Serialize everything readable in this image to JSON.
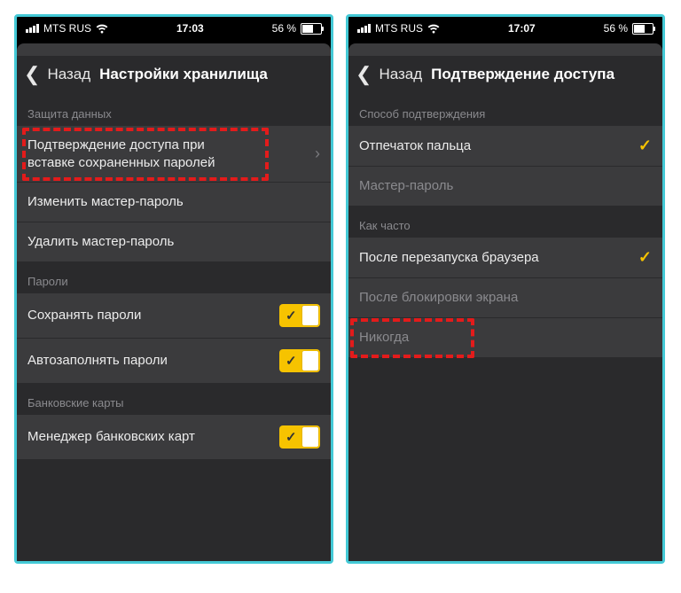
{
  "left": {
    "status": {
      "carrier": "MTS RUS",
      "time": "17:03",
      "battery": "56 %"
    },
    "nav": {
      "back": "Назад",
      "title": "Настройки хранилища"
    },
    "section1": {
      "header": "Защита данных",
      "row1": "Подтверждение доступа при вставке сохраненных паролей",
      "row2": "Изменить мастер-пароль",
      "row3": "Удалить мастер-пароль"
    },
    "section2": {
      "header": "Пароли",
      "row1": "Сохранять пароли",
      "row2": "Автозаполнять пароли"
    },
    "section3": {
      "header": "Банковские карты",
      "row1": "Менеджер банковских карт"
    }
  },
  "right": {
    "status": {
      "carrier": "MTS RUS",
      "time": "17:07",
      "battery": "56 %"
    },
    "nav": {
      "back": "Назад",
      "title": "Подтверждение доступа"
    },
    "section1": {
      "header": "Способ подтверждения",
      "row1": "Отпечаток пальца",
      "row2": "Мастер-пароль"
    },
    "section2": {
      "header": "Как часто",
      "row1": "После перезапуска браузера",
      "row2": "После блокировки экрана",
      "row3": "Никогда"
    }
  }
}
